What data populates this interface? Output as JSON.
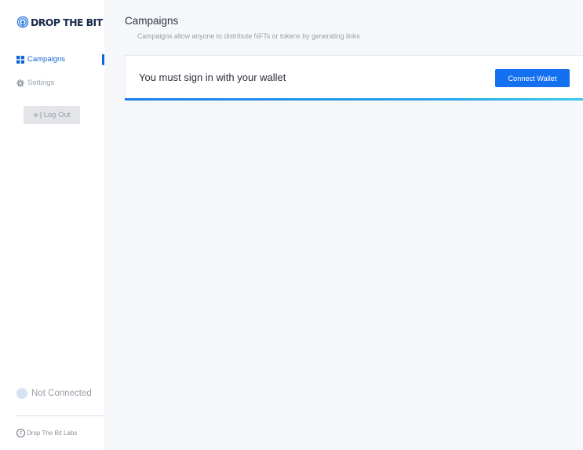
{
  "sidebar": {
    "logo_text": "DROP THE BIT",
    "items": [
      {
        "label": "Campaigns",
        "icon": "grid-icon",
        "active": true
      },
      {
        "label": "Settings",
        "icon": "gear-icon",
        "active": false
      }
    ],
    "logout_label": "Log Out",
    "status_text": "Not Connected",
    "footer_text": "Drop The Bit Labs"
  },
  "main": {
    "title": "Campaigns",
    "subtitle": "Campaigns allow anyone to distribute NFTs or tokens by generating links",
    "card": {
      "message": "You must sign in with your wallet",
      "button_label": "Connect Wallet"
    }
  },
  "colors": {
    "accent": "#1570ef",
    "active_nav": "#1565d8",
    "muted_text": "#9aa1ab",
    "background": "#f6f7fa"
  }
}
